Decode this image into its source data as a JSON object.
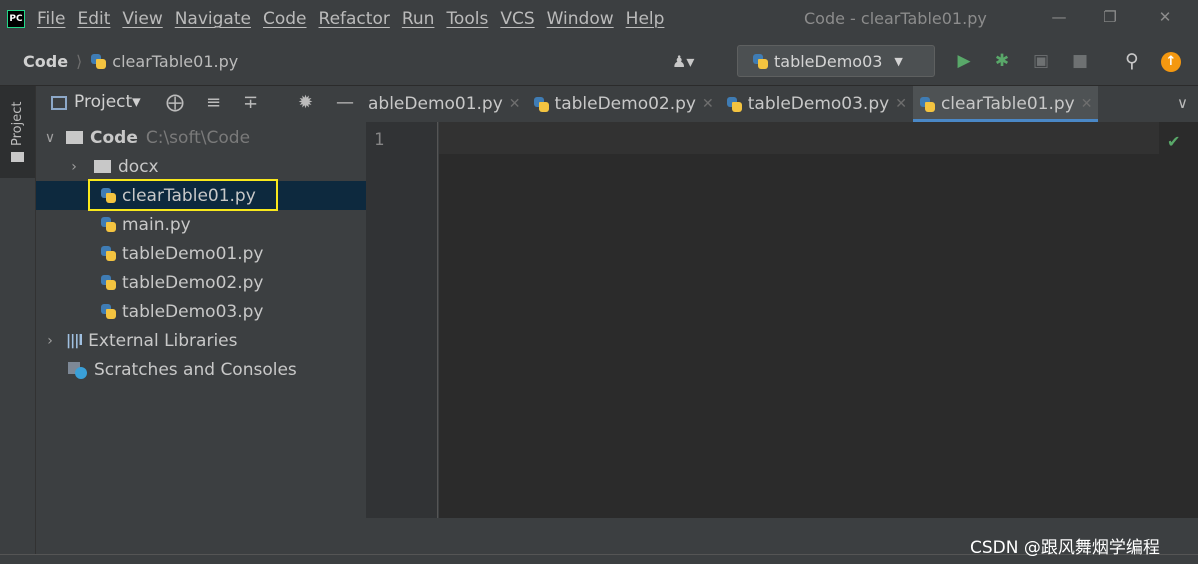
{
  "menubar": {
    "logo": "PC",
    "items": [
      "File",
      "Edit",
      "View",
      "Navigate",
      "Code",
      "Refactor",
      "Run",
      "Tools",
      "VCS",
      "Window",
      "Help"
    ],
    "window_title": "Code - clearTable01.py"
  },
  "navbar": {
    "root": "Code",
    "file": "clearTable01.py",
    "run_config": "tableDemo03"
  },
  "stripe": {
    "label": "Project"
  },
  "project": {
    "title": "Project",
    "root_name": "Code",
    "root_path": "C:\\soft\\Code",
    "docx": "docx",
    "files": [
      "clearTable01.py",
      "main.py",
      "tableDemo01.py",
      "tableDemo02.py",
      "tableDemo03.py"
    ],
    "external": "External Libraries",
    "scratches": "Scratches and Consoles"
  },
  "tabs": [
    {
      "label": "ableDemo01.py"
    },
    {
      "label": "tableDemo02.py"
    },
    {
      "label": "tableDemo03.py"
    },
    {
      "label": "clearTable01.py"
    }
  ],
  "editor": {
    "line_number": "1"
  },
  "watermark": "CSDN @跟风舞烟学编程",
  "colors": {
    "accent": "#4a88c7",
    "selection": "#0d293e",
    "highlight_box": "#f8e81c",
    "run_green": "#59a869"
  }
}
